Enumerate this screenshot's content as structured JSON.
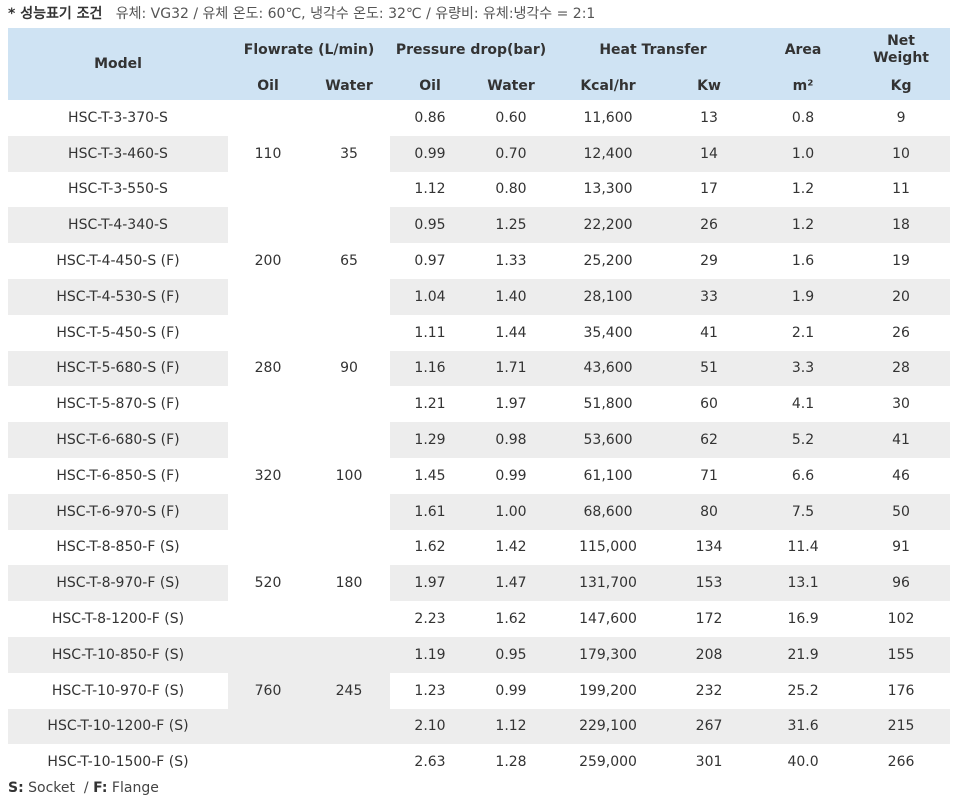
{
  "conditions": {
    "label": "* 성능표기 조건",
    "text": "유체: VG32 / 유체 온도: 60℃, 냉각수 온도: 32℃ / 유량비:  유체:냉각수 = 2:1"
  },
  "header": {
    "model": "Model",
    "flowrate": "Flowrate (L/min)",
    "pressure": "Pressure drop(bar)",
    "heat": "Heat Transfer",
    "area": "Area",
    "weight": "Net Weight",
    "oil": "Oil",
    "water": "Water",
    "kcal": "Kcal/hr",
    "kw": "Kw",
    "m2": "m²",
    "kg": "Kg"
  },
  "groups": [
    {
      "oil": "110",
      "water": "35"
    },
    {
      "oil": "200",
      "water": "65"
    },
    {
      "oil": "280",
      "water": "90"
    },
    {
      "oil": "320",
      "water": "100"
    },
    {
      "oil": "520",
      "water": "180"
    },
    {
      "oil": "760",
      "water": "245"
    }
  ],
  "rows": [
    {
      "model": "HSC-T-3-370-S",
      "p_oil": "0.86",
      "p_water": "0.60",
      "kcal": "11,600",
      "kw": "13",
      "area": "0.8",
      "kg": "9"
    },
    {
      "model": "HSC-T-3-460-S",
      "p_oil": "0.99",
      "p_water": "0.70",
      "kcal": "12,400",
      "kw": "14",
      "area": "1.0",
      "kg": "10"
    },
    {
      "model": "HSC-T-3-550-S",
      "p_oil": "1.12",
      "p_water": "0.80",
      "kcal": "13,300",
      "kw": "17",
      "area": "1.2",
      "kg": "11"
    },
    {
      "model": "HSC-T-4-340-S",
      "p_oil": "0.95",
      "p_water": "1.25",
      "kcal": "22,200",
      "kw": "26",
      "area": "1.2",
      "kg": "18"
    },
    {
      "model": "HSC-T-4-450-S (F)",
      "p_oil": "0.97",
      "p_water": "1.33",
      "kcal": "25,200",
      "kw": "29",
      "area": "1.6",
      "kg": "19"
    },
    {
      "model": "HSC-T-4-530-S (F)",
      "p_oil": "1.04",
      "p_water": "1.40",
      "kcal": "28,100",
      "kw": "33",
      "area": "1.9",
      "kg": "20"
    },
    {
      "model": "HSC-T-5-450-S (F)",
      "p_oil": "1.11",
      "p_water": "1.44",
      "kcal": "35,400",
      "kw": "41",
      "area": "2.1",
      "kg": "26"
    },
    {
      "model": "HSC-T-5-680-S (F)",
      "p_oil": "1.16",
      "p_water": "1.71",
      "kcal": "43,600",
      "kw": "51",
      "area": "3.3",
      "kg": "28"
    },
    {
      "model": "HSC-T-5-870-S (F)",
      "p_oil": "1.21",
      "p_water": "1.97",
      "kcal": "51,800",
      "kw": "60",
      "area": "4.1",
      "kg": "30"
    },
    {
      "model": "HSC-T-6-680-S (F)",
      "p_oil": "1.29",
      "p_water": "0.98",
      "kcal": "53,600",
      "kw": "62",
      "area": "5.2",
      "kg": "41"
    },
    {
      "model": "HSC-T-6-850-S (F)",
      "p_oil": "1.45",
      "p_water": "0.99",
      "kcal": "61,100",
      "kw": "71",
      "area": "6.6",
      "kg": "46"
    },
    {
      "model": "HSC-T-6-970-S (F)",
      "p_oil": "1.61",
      "p_water": "1.00",
      "kcal": "68,600",
      "kw": "80",
      "area": "7.5",
      "kg": "50"
    },
    {
      "model": "HSC-T-8-850-F (S)",
      "p_oil": "1.62",
      "p_water": "1.42",
      "kcal": "115,000",
      "kw": "134",
      "area": "11.4",
      "kg": "91"
    },
    {
      "model": "HSC-T-8-970-F (S)",
      "p_oil": "1.97",
      "p_water": "1.47",
      "kcal": "131,700",
      "kw": "153",
      "area": "13.1",
      "kg": "96"
    },
    {
      "model": "HSC-T-8-1200-F (S)",
      "p_oil": "2.23",
      "p_water": "1.62",
      "kcal": "147,600",
      "kw": "172",
      "area": "16.9",
      "kg": "102"
    },
    {
      "model": "HSC-T-10-850-F (S)",
      "p_oil": "1.19",
      "p_water": "0.95",
      "kcal": "179,300",
      "kw": "208",
      "area": "21.9",
      "kg": "155"
    },
    {
      "model": "HSC-T-10-970-F (S)",
      "p_oil": "1.23",
      "p_water": "0.99",
      "kcal": "199,200",
      "kw": "232",
      "area": "25.2",
      "kg": "176"
    },
    {
      "model": "HSC-T-10-1200-F (S)",
      "p_oil": "2.10",
      "p_water": "1.12",
      "kcal": "229,100",
      "kw": "267",
      "area": "31.6",
      "kg": "215"
    },
    {
      "model": "HSC-T-10-1500-F (S)",
      "p_oil": "2.63",
      "p_water": "1.28",
      "kcal": "259,000",
      "kw": "301",
      "area": "40.0",
      "kg": "266"
    }
  ],
  "footnote": {
    "s_key": "S:",
    "s_val": " Socket  / ",
    "f_key": "F:",
    "f_val": " Flange"
  }
}
